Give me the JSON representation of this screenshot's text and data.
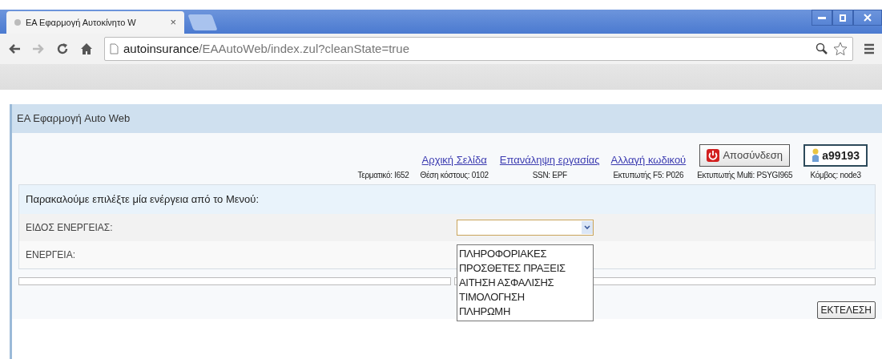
{
  "browser": {
    "tab": {
      "title": "ΕΑ Εφαρμογή Αυτοκίνητο W",
      "close": "×"
    },
    "url_host": "autoinsurance",
    "url_path": "/EAAutoWeb/index.zul?cleanState=true"
  },
  "app": {
    "title": "ΕΑ Εφαρμογή Auto Web",
    "header": {
      "links": [
        "Αρχική Σελίδα",
        "Επανάληψη εργασίας",
        "Αλλαγή κωδικού"
      ],
      "info": [
        "Τερματικό: I652",
        "Θέση κόστους: 0102",
        "SSN: EPF",
        "Εκτυπωτής F5: P026",
        "Εκτυπωτής Multi: PSYGI965",
        "Κόμβος: node3"
      ],
      "logout": "Αποσύνδεση",
      "user": "a99193"
    },
    "message": "Παρακαλούμε επιλέξτε μία ενέργεια από το Μενού:",
    "fields": [
      {
        "label": "ΕΙΔΟΣ ΕΝΕΡΓΕΙΑΣ:"
      },
      {
        "label": "ΕΝΕΡΓΕΙΑ:"
      }
    ],
    "dropdown_options": [
      "ΠΛΗΡΟΦΟΡΙΑΚΕΣ",
      "ΠΡΟΣΘΕΤΕΣ ΠΡΑΞΕΙΣ",
      "ΑΙΤΗΣΗ ΑΣΦΑΛΙΣΗΣ",
      "ΤΙΜΟΛΟΓΗΣΗ",
      "ΠΛΗΡΩΜΗ"
    ],
    "execute": "ΕΚΤΕΛΕΣΗ"
  }
}
